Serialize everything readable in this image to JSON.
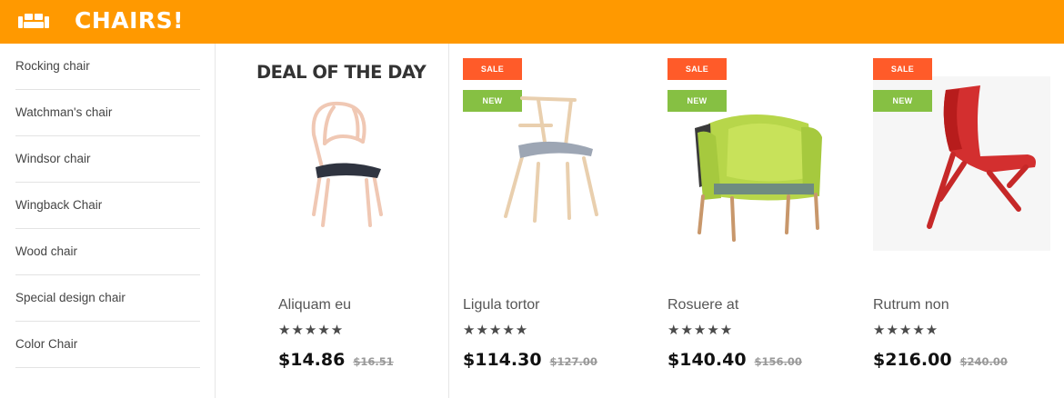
{
  "header": {
    "title": "CHAIRS!",
    "icon": "sofa-icon"
  },
  "sidebar": {
    "items": [
      {
        "label": "Rocking chair"
      },
      {
        "label": "Watchman's chair"
      },
      {
        "label": "Windsor chair"
      },
      {
        "label": "Wingback Chair"
      },
      {
        "label": "Wood chair"
      },
      {
        "label": "Special design chair"
      },
      {
        "label": "Color Chair"
      }
    ]
  },
  "deal": {
    "title": "DEAL OF THE DAY"
  },
  "badges": {
    "sale": "SALE",
    "new": "NEW"
  },
  "products": [
    {
      "name": "Aliquam eu",
      "stars": "★★★★★",
      "price": "$14.86",
      "old_price": "$16.51"
    },
    {
      "name": "Ligula tortor",
      "stars": "★★★★★",
      "price": "$114.30",
      "old_price": "$127.00"
    },
    {
      "name": "Rosuere at",
      "stars": "★★★★★",
      "price": "$140.40",
      "old_price": "$156.00"
    },
    {
      "name": "Rutrum non",
      "stars": "★★★★★",
      "price": "$216.00",
      "old_price": "$240.00"
    }
  ],
  "colors": {
    "header": "#ff9900",
    "sale": "#ff5b29",
    "new": "#86c043"
  }
}
